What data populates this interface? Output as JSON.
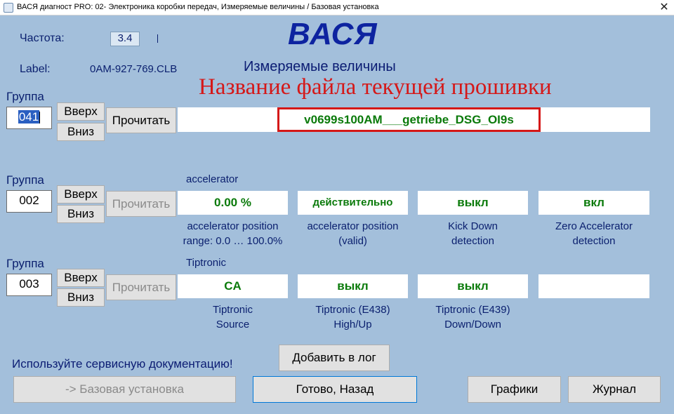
{
  "window": {
    "title": "ВАСЯ диагност PRO: 02- Электроника коробки передач,  Измеряемые величины / Базовая установка",
    "close_glyph": "✕"
  },
  "header": {
    "freq_label": "Частота:",
    "freq_value": "3.4",
    "label_label": "Label:",
    "label_value": "0AM-927-769.CLB",
    "app_title": "ВАСЯ",
    "subtitle": "Измеряемые величины"
  },
  "annotation": "Название файла текущей прошивки",
  "groups": [
    {
      "label": "Группа",
      "number": "041",
      "up_label": "Вверх",
      "down_label": "Вниз",
      "read_label": "Прочитать",
      "read_enabled": true,
      "firmware_value": "v0699s100AM___getriebe_DSG_OI9s"
    },
    {
      "label": "Группа",
      "number": "002",
      "up_label": "Вверх",
      "down_label": "Вниз",
      "read_label": "Прочитать",
      "read_enabled": false,
      "title": "accelerator",
      "fields": [
        {
          "value": "0.00 %",
          "desc1": "accelerator position",
          "desc2": "range: 0.0 … 100.0%"
        },
        {
          "value": "действительно",
          "desc1": "accelerator position",
          "desc2": "(valid)"
        },
        {
          "value": "выкл",
          "desc1": "Kick Down",
          "desc2": "detection"
        },
        {
          "value": "вкл",
          "desc1": "Zero Accelerator",
          "desc2": "detection"
        }
      ]
    },
    {
      "label": "Группа",
      "number": "003",
      "up_label": "Вверх",
      "down_label": "Вниз",
      "read_label": "Прочитать",
      "read_enabled": false,
      "title": "Tiptronic",
      "fields": [
        {
          "value": "CA",
          "desc1": "Tiptronic",
          "desc2": "Source"
        },
        {
          "value": "выкл",
          "desc1": "Tiptronic (E438)",
          "desc2": "High/Up"
        },
        {
          "value": "выкл",
          "desc1": "Tiptronic (E439)",
          "desc2": "Down/Down"
        },
        {
          "value": "",
          "desc1": "",
          "desc2": ""
        }
      ]
    }
  ],
  "footer": {
    "hint": "Используйте сервисную документацию!",
    "add_log": "Добавить в лог",
    "basic_setting": "-> Базовая установка",
    "done_back": "Готово, Назад",
    "graphs": "Графики",
    "journal": "Журнал"
  },
  "colors": {
    "background": "#a3bfdb",
    "value_text": "#0a7a0a",
    "annotation": "#d51818",
    "title": "#0d23a0"
  }
}
